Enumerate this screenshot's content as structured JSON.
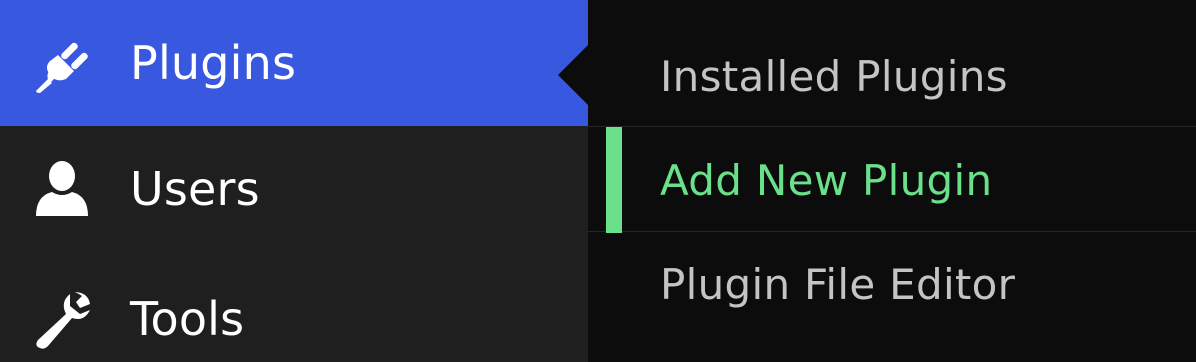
{
  "menu": {
    "items": [
      {
        "label": "Plugins",
        "icon": "plug-icon"
      },
      {
        "label": "Users",
        "icon": "user-icon"
      },
      {
        "label": "Tools",
        "icon": "wrench-icon"
      }
    ]
  },
  "submenu": {
    "items": [
      {
        "label": "Installed Plugins"
      },
      {
        "label": "Add New Plugin"
      },
      {
        "label": "Plugin File Editor"
      }
    ]
  },
  "colors": {
    "menu_bg": "#1f1f1f",
    "current_bg": "#3858e0",
    "submenu_bg": "#0c0c0c",
    "active_accent": "#6be08a",
    "submenu_text": "#c4c4c4"
  }
}
